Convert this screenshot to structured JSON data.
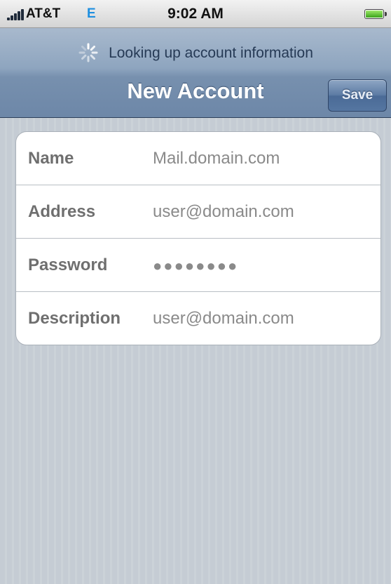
{
  "status_bar": {
    "carrier": "AT&T",
    "network": "E",
    "time": "9:02 AM",
    "battery_level": 1.0
  },
  "nav": {
    "prompt": "Looking up account information",
    "title": "New Account",
    "save_label": "Save"
  },
  "form": {
    "rows": [
      {
        "label": "Name",
        "value": "Mail.domain.com"
      },
      {
        "label": "Address",
        "value": "user@domain.com"
      },
      {
        "label": "Password",
        "value": "●●●●●●●●"
      },
      {
        "label": "Description",
        "value": "user@domain.com"
      }
    ]
  },
  "colors": {
    "nav_gradient_top": "#a8b9cd",
    "nav_gradient_bottom": "#6d87a8",
    "background_stripe": "#c5ccd4",
    "network_indicator": "#1e8fe0"
  },
  "icons": {
    "signal": "signal-strength-icon",
    "spinner": "activity-spinner-icon",
    "battery": "battery-icon"
  }
}
